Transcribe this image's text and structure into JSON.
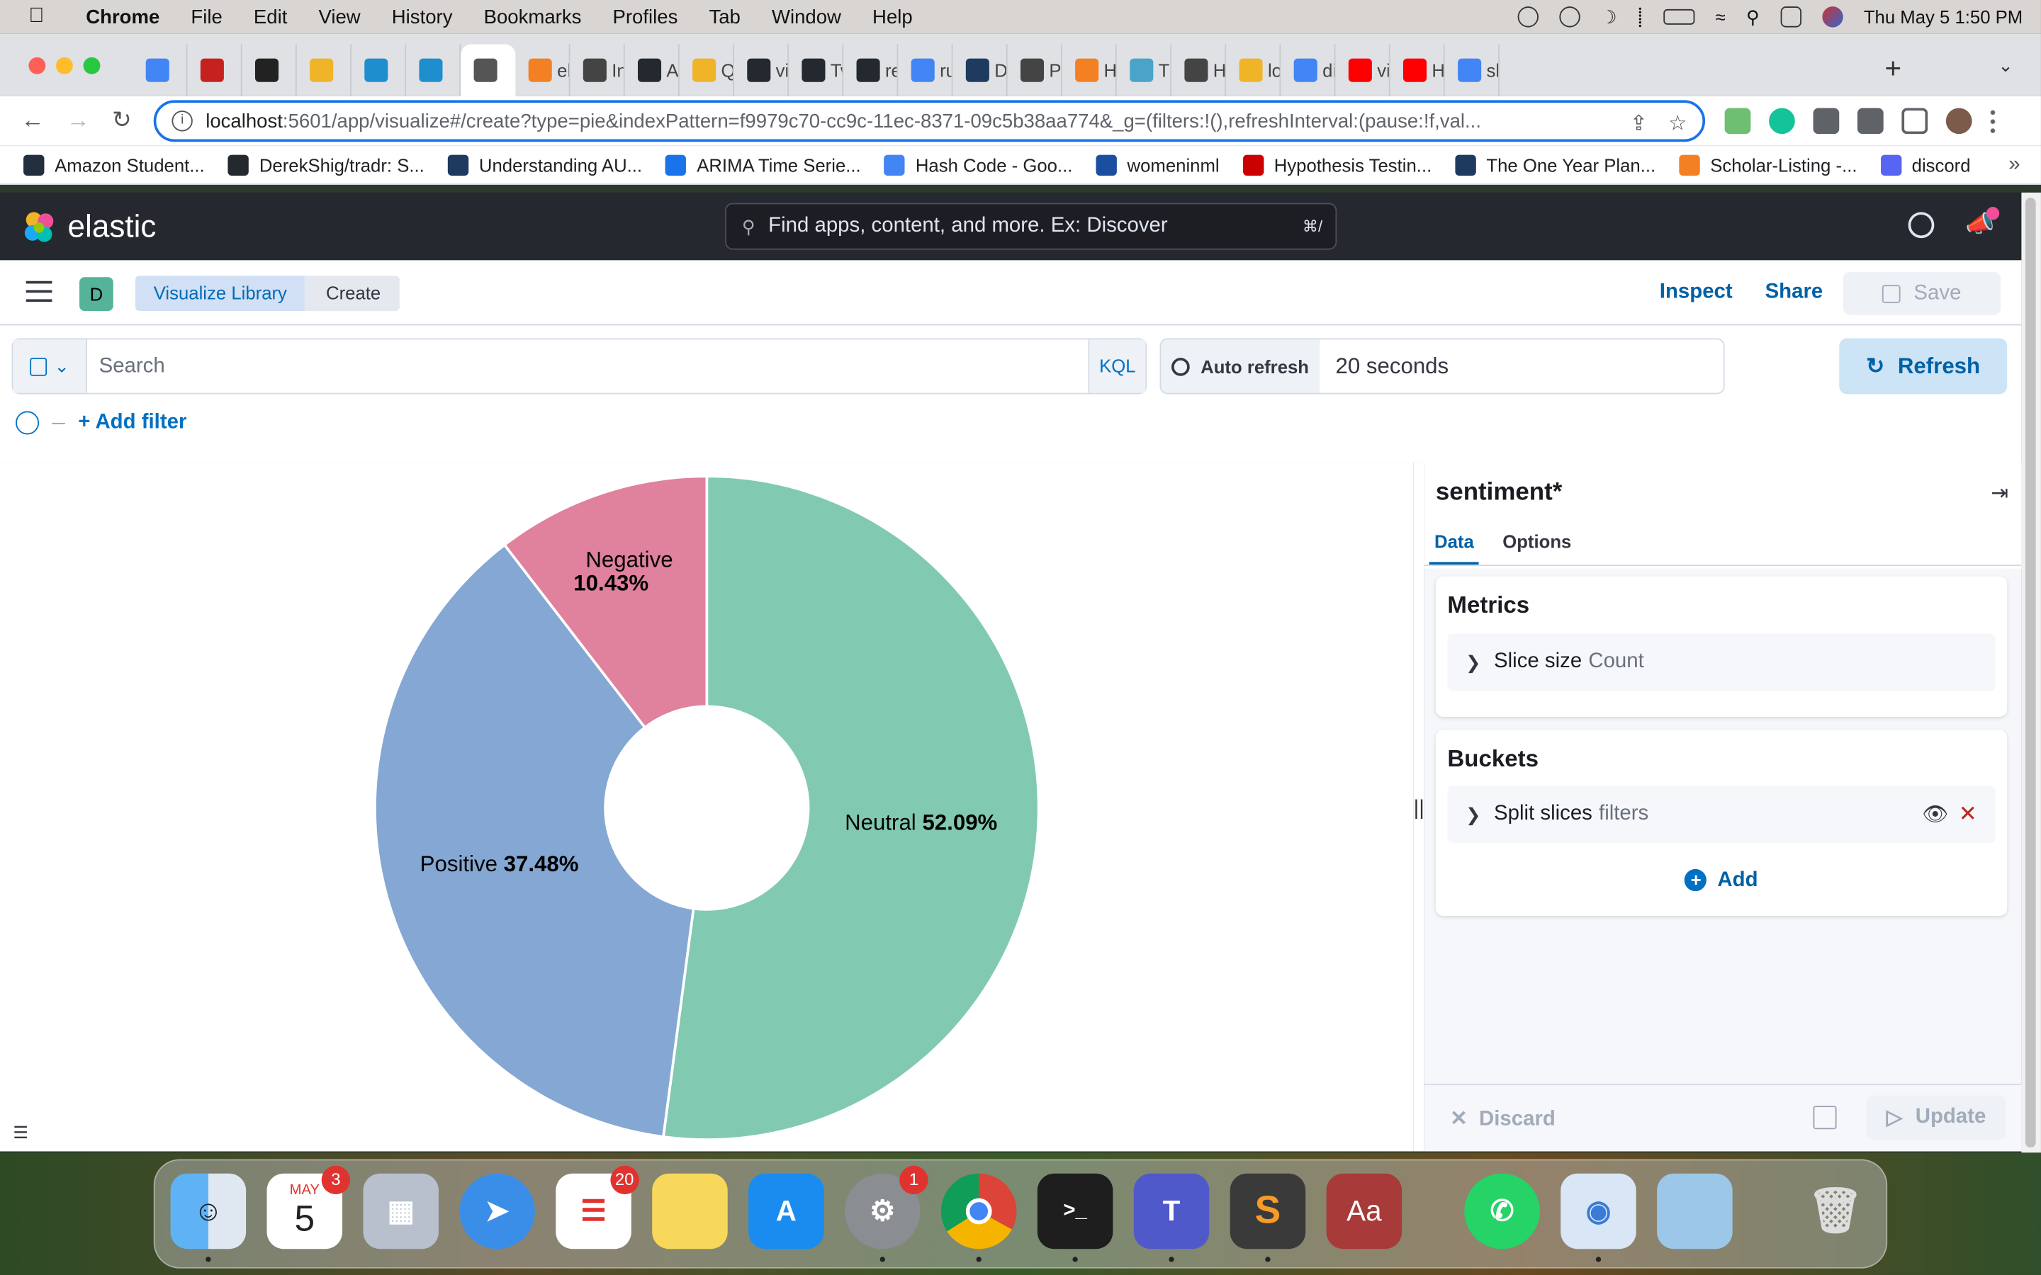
{
  "menubar": {
    "app": "Chrome",
    "items": [
      "File",
      "Edit",
      "View",
      "History",
      "Bookmarks",
      "Profiles",
      "Tab",
      "Window",
      "Help"
    ],
    "clock": "Thu May 5  1:50 PM"
  },
  "browser": {
    "tabs": [
      {
        "label": "",
        "color": "#4285f4"
      },
      {
        "label": "",
        "color": "#c5221f"
      },
      {
        "label": "",
        "color": "#222222"
      },
      {
        "label": "",
        "color": "#f0b429"
      },
      {
        "label": "",
        "color": "#1f8ecf"
      },
      {
        "label": "",
        "color": "#1f8ecf"
      },
      {
        "label": "",
        "color": "#555555",
        "active": true
      },
      {
        "label": "ela",
        "color": "#f48024"
      },
      {
        "label": "In:",
        "color": "#444444"
      },
      {
        "label": "As",
        "color": "#24292f"
      },
      {
        "label": "Qu",
        "color": "#f0b429"
      },
      {
        "label": "vir",
        "color": "#24292f"
      },
      {
        "label": "Tw",
        "color": "#24292f"
      },
      {
        "label": "re",
        "color": "#24292f"
      },
      {
        "label": "ru",
        "color": "#4285f4"
      },
      {
        "label": "Da",
        "color": "#1e3a5f"
      },
      {
        "label": "Py",
        "color": "#444444"
      },
      {
        "label": "Hc",
        "color": "#f48024"
      },
      {
        "label": "Th",
        "color": "#4aa3c8"
      },
      {
        "label": "Ho",
        "color": "#444444"
      },
      {
        "label": "loc",
        "color": "#f0b429"
      },
      {
        "label": "dis",
        "color": "#4285f4"
      },
      {
        "label": "vis",
        "color": "#ff0000"
      },
      {
        "label": "Ho",
        "color": "#ff0000"
      },
      {
        "label": "sh",
        "color": "#4285f4"
      }
    ],
    "url_host": "localhost",
    "url_path": ":5601/app/visualize#/create?type=pie&indexPattern=f9979c70-cc9c-11ec-8371-09c5b38aa774&_g=(filters:!(),refreshInterval:(pause:!f,val...",
    "bookmarks": [
      {
        "label": "Amazon Student...",
        "color": "#232f3e"
      },
      {
        "label": "DerekShig/tradr: S...",
        "color": "#24292f"
      },
      {
        "label": "Understanding AU...",
        "color": "#1e3a5f"
      },
      {
        "label": "ARIMA Time Serie...",
        "color": "#1a73e8"
      },
      {
        "label": "Hash Code - Goo...",
        "color": "#4285f4"
      },
      {
        "label": "womeninml",
        "color": "#1a4fa0"
      },
      {
        "label": "Hypothesis Testin...",
        "color": "#cc0000"
      },
      {
        "label": "The One Year Plan...",
        "color": "#1e3a5f"
      },
      {
        "label": "Scholar-Listing -...",
        "color": "#f48024"
      },
      {
        "label": "discord",
        "color": "#5865f2"
      }
    ]
  },
  "kibana": {
    "brand": "elastic",
    "search_placeholder": "Find apps, content, and more. Ex: Discover",
    "search_shortcut": "⌘/",
    "space_letter": "D",
    "breadcrumbs": [
      "Visualize Library",
      "Create"
    ],
    "actions": {
      "inspect": "Inspect",
      "share": "Share",
      "save": "Save"
    },
    "query": {
      "placeholder": "Search",
      "language": "KQL"
    },
    "refresh": {
      "auto_label": "Auto refresh",
      "interval": "20 seconds",
      "button": "Refresh"
    },
    "add_filter": "+ Add filter",
    "editor": {
      "title": "sentiment*",
      "tabs": [
        "Data",
        "Options"
      ],
      "metrics": {
        "heading": "Metrics",
        "agg_label": "Slice size",
        "agg_sub": "Count"
      },
      "buckets": {
        "heading": "Buckets",
        "agg_label": "Split slices",
        "agg_sub": "filters",
        "add_label": "Add"
      },
      "footer": {
        "discard": "Discard",
        "update": "Update"
      }
    }
  },
  "chart_data": {
    "type": "pie",
    "donut": true,
    "slices": [
      {
        "name": "Neutral",
        "percent": 52.09,
        "color": "#82c9b2",
        "label_text": "52.09%"
      },
      {
        "name": "Positive",
        "percent": 37.48,
        "color": "#85a7d3",
        "label_text": "37.48%"
      },
      {
        "name": "Negative",
        "percent": 10.43,
        "color": "#e0819e",
        "label_text": "10.43%"
      }
    ]
  },
  "dock": {
    "badges": {
      "calendar": "3",
      "reminders": "20",
      "settings": "1"
    },
    "calendar_month": "MAY",
    "calendar_day": "5"
  }
}
